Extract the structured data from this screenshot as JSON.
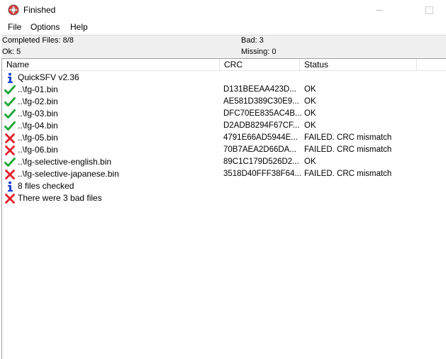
{
  "window": {
    "title": "Finished",
    "icon": "lifebuoy-icon"
  },
  "menu": [
    "File",
    "Options",
    "Help"
  ],
  "summary": {
    "completed": "Completed Files: 8/8",
    "ok": "Ok: 5",
    "bad": "Bad: 3",
    "missing": "Missing: 0"
  },
  "columns": {
    "name": "Name",
    "crc": "CRC",
    "status": "Status"
  },
  "rows": [
    {
      "icon": "info",
      "name": "QuickSFV v2.36",
      "crc": "",
      "status": ""
    },
    {
      "icon": "check",
      "name": "..\\fg-01.bin",
      "crc": "D131BEEAA423D...",
      "status": "OK"
    },
    {
      "icon": "check",
      "name": "..\\fg-02.bin",
      "crc": "AE581D389C30E9...",
      "status": "OK"
    },
    {
      "icon": "check",
      "name": "..\\fg-03.bin",
      "crc": "DFC70EE835AC4B...",
      "status": "OK"
    },
    {
      "icon": "check",
      "name": "..\\fg-04.bin",
      "crc": "D2ADB8294F67CF...",
      "status": "OK"
    },
    {
      "icon": "cross",
      "name": "..\\fg-05.bin",
      "crc": "4791E66AD5944E...",
      "status": "FAILED.  CRC mismatch"
    },
    {
      "icon": "cross",
      "name": "..\\fg-06.bin",
      "crc": "70B7AEA2D66DA...",
      "status": "FAILED.  CRC mismatch"
    },
    {
      "icon": "check",
      "name": "..\\fg-selective-english.bin",
      "crc": "89C1C179D526D2...",
      "status": "OK"
    },
    {
      "icon": "cross",
      "name": "..\\fg-selective-japanese.bin",
      "crc": "3518D40FFF38F64...",
      "status": "FAILED.  CRC mismatch"
    },
    {
      "icon": "info",
      "name": "8 files checked",
      "crc": "",
      "status": ""
    },
    {
      "icon": "cross",
      "name": "There were 3 bad files",
      "crc": "",
      "status": ""
    }
  ],
  "colors": {
    "check": "#22a83a",
    "cross": "#e0202a",
    "info": "#1a3fd0"
  }
}
